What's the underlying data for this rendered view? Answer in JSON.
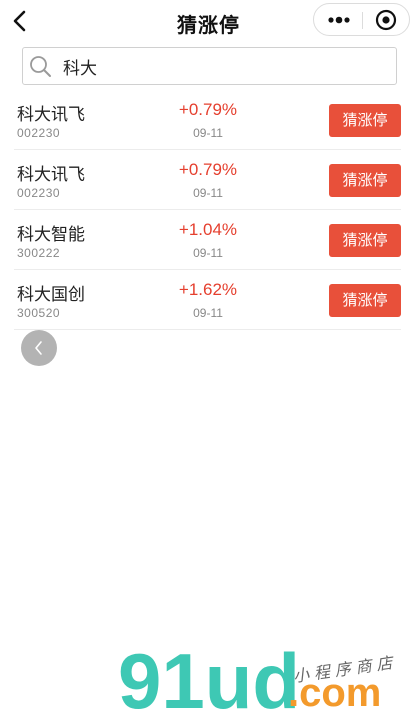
{
  "header": {
    "title": "猜涨停"
  },
  "search": {
    "value": "科大",
    "placeholder": ""
  },
  "stocks": [
    {
      "name": "科大讯飞",
      "code": "002230",
      "change": "+0.79%",
      "date": "09-11",
      "button": "猜涨停"
    },
    {
      "name": "科大讯飞",
      "code": "002230",
      "change": "+0.79%",
      "date": "09-11",
      "button": "猜涨停"
    },
    {
      "name": "科大智能",
      "code": "300222",
      "change": "+1.04%",
      "date": "09-11",
      "button": "猜涨停"
    },
    {
      "name": "科大国创",
      "code": "300520",
      "change": "+1.62%",
      "date": "09-11",
      "button": "猜涨停"
    }
  ],
  "colors": {
    "accent_red": "#e8503a",
    "change_red": "#e53f2e",
    "watermark_teal": "#3ec8b4",
    "watermark_orange": "#f39a2c"
  },
  "watermark": {
    "brand": "91ud",
    "domain": ".com",
    "tagline": "小程序商店"
  }
}
